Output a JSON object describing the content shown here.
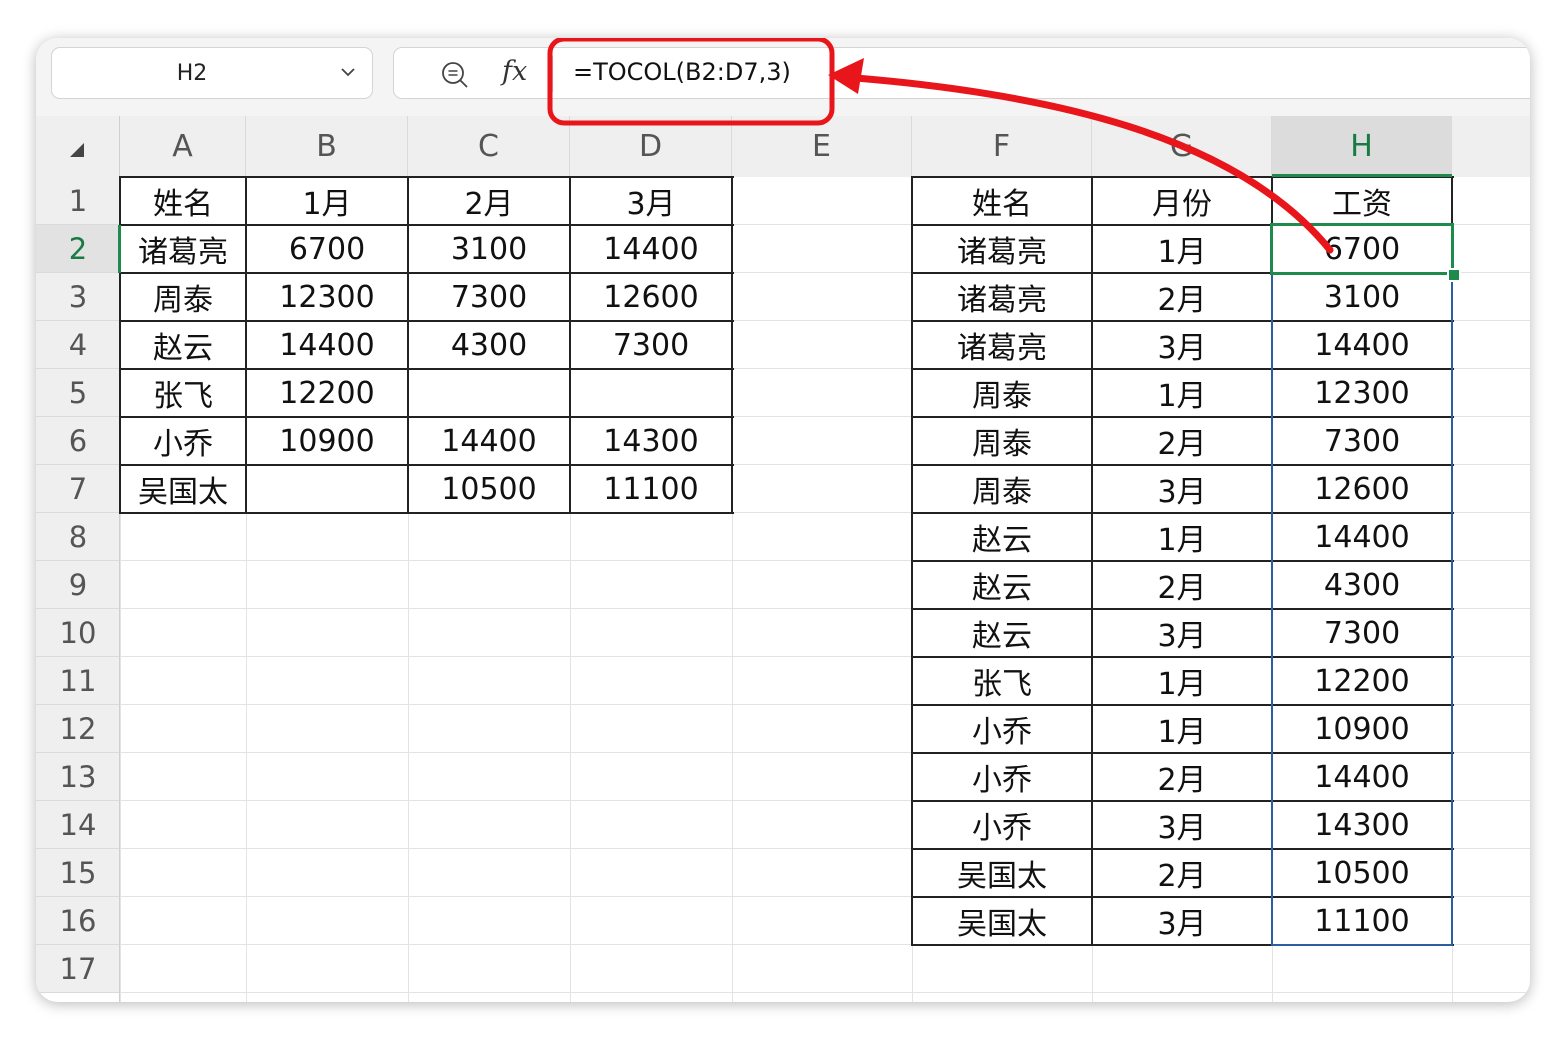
{
  "name_box": {
    "value": "H2"
  },
  "formula_bar": {
    "formula": "=TOCOL(B2:D7,3)",
    "fx_label": "fx"
  },
  "columns": [
    "A",
    "B",
    "C",
    "D",
    "E",
    "F",
    "G",
    "H"
  ],
  "active_cell": {
    "column": "H",
    "row": "2"
  },
  "rows": [
    "1",
    "2",
    "3",
    "4",
    "5",
    "6",
    "7",
    "8",
    "9",
    "10",
    "11",
    "12",
    "13",
    "14",
    "15",
    "16",
    "17"
  ],
  "source_table": {
    "headers": [
      "姓名",
      "1月",
      "2月",
      "3月"
    ],
    "rows": [
      [
        "诸葛亮",
        "6700",
        "3100",
        "14400"
      ],
      [
        "周泰",
        "12300",
        "7300",
        "12600"
      ],
      [
        "赵云",
        "14400",
        "4300",
        "7300"
      ],
      [
        "张飞",
        "12200",
        "",
        ""
      ],
      [
        "小乔",
        "10900",
        "14400",
        "14300"
      ],
      [
        "吴国太",
        "",
        "10500",
        "11100"
      ]
    ]
  },
  "result_table": {
    "headers": [
      "姓名",
      "月份",
      "工资"
    ],
    "rows": [
      [
        "诸葛亮",
        "1月",
        "6700"
      ],
      [
        "诸葛亮",
        "2月",
        "3100"
      ],
      [
        "诸葛亮",
        "3月",
        "14400"
      ],
      [
        "周泰",
        "1月",
        "12300"
      ],
      [
        "周泰",
        "2月",
        "7300"
      ],
      [
        "周泰",
        "3月",
        "12600"
      ],
      [
        "赵云",
        "1月",
        "14400"
      ],
      [
        "赵云",
        "2月",
        "4300"
      ],
      [
        "赵云",
        "3月",
        "7300"
      ],
      [
        "张飞",
        "1月",
        "12200"
      ],
      [
        "小乔",
        "1月",
        "10900"
      ],
      [
        "小乔",
        "2月",
        "14400"
      ],
      [
        "小乔",
        "3月",
        "14300"
      ],
      [
        "吴国太",
        "2月",
        "10500"
      ],
      [
        "吴国太",
        "3月",
        "11100"
      ]
    ]
  },
  "colors": {
    "selection": "#1e8a4c",
    "annotation": "#e8151b",
    "range": "#2c5ea0"
  },
  "icons": {
    "name_box_caret": "chevron-down-icon",
    "zoom": "zoom-formula-icon",
    "fx": "fx-icon"
  }
}
